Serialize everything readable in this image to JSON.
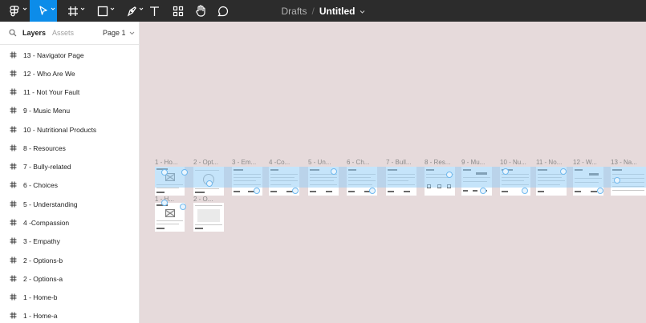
{
  "toolbar": {
    "tools": [
      {
        "name": "main-menu",
        "icon": "figma-logo-icon",
        "active": false,
        "caret": true
      },
      {
        "name": "move",
        "icon": "cursor-icon",
        "active": true,
        "caret": true
      },
      {
        "name": "frame",
        "icon": "frame-hash-icon",
        "active": false,
        "caret": true
      },
      {
        "name": "shape",
        "icon": "rectangle-icon",
        "active": false,
        "caret": true
      },
      {
        "name": "pen",
        "icon": "pen-icon",
        "active": false,
        "caret": true
      },
      {
        "name": "text",
        "icon": "text-icon",
        "active": false,
        "caret": false
      },
      {
        "name": "resources",
        "icon": "resources-icon",
        "active": false,
        "caret": false
      },
      {
        "name": "hand",
        "icon": "hand-icon",
        "active": false,
        "caret": false
      },
      {
        "name": "comment",
        "icon": "comment-icon",
        "active": false,
        "caret": false
      }
    ],
    "breadcrumb": "Drafts",
    "separator": "/",
    "document_title": "Untitled"
  },
  "sidebar": {
    "tab_layers": "Layers",
    "tab_assets": "Assets",
    "page": "Page 1",
    "layers": [
      "13 - Navigator Page",
      "12 - Who Are We",
      "11 - Not Your Fault",
      "9 - Music Menu",
      "10 - Nutritional Products",
      "8 - Resources",
      "7 - Bully-related",
      "6 - Choices",
      "5 - Understanding",
      "4 -Compassion",
      "3 - Empathy",
      "2 - Options-b",
      "2 - Options-a",
      "1 - Home-b",
      "1 - Home-a"
    ]
  },
  "canvas": {
    "background": "#e6dadb",
    "frames_row1": [
      "1 - Ho...",
      "2 - Opt...",
      "3 - Em...",
      "4 -Co...",
      "5 - Un...",
      "6 - Ch...",
      "7 - Bull...",
      "8 - Res...",
      "9 - Mu...",
      "10 - Nu...",
      "11 - No...",
      "12 - W...",
      "13 - Na..."
    ],
    "frames_row2": [
      "1 - H...",
      "2 - O..."
    ]
  },
  "colors": {
    "toolbar_bg": "#2c2c2c",
    "accent": "#0c8ce9",
    "sidebar_bg": "#ffffff",
    "connector": "#96cdf5"
  }
}
